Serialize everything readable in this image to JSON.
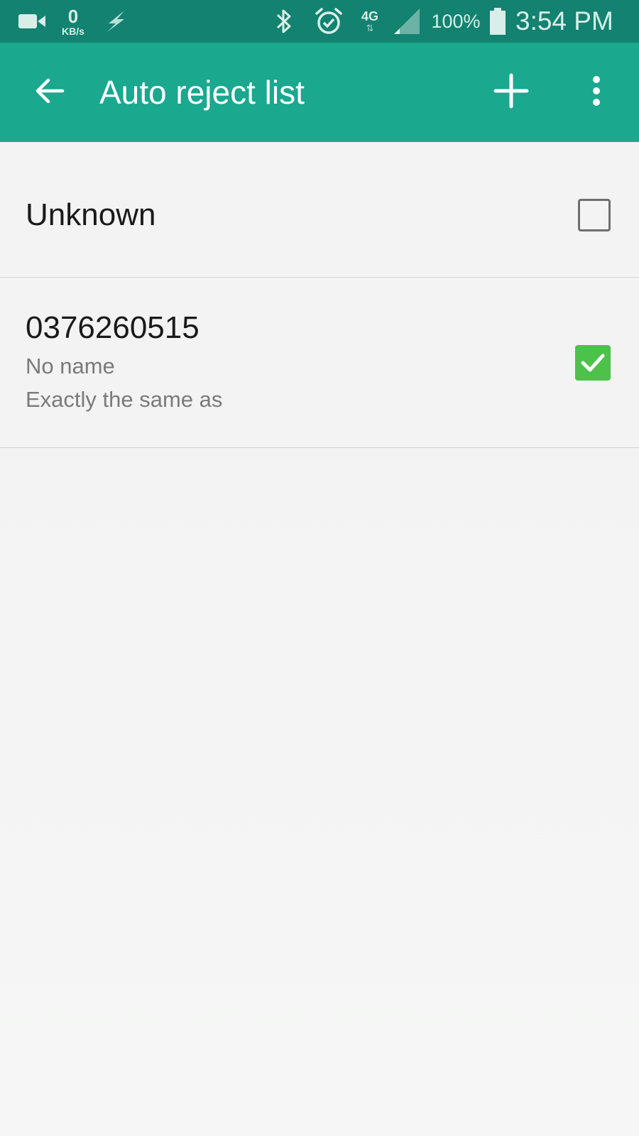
{
  "status_bar": {
    "network_speed_value": "0",
    "network_speed_unit": "KB/s",
    "network_type": "4G",
    "network_arrows": "⇅",
    "battery_percent": "100%",
    "time": "3:54 PM",
    "icons": [
      "video-icon",
      "flash-icon",
      "bluetooth-icon",
      "alarm-icon",
      "signal-icon",
      "battery-icon"
    ]
  },
  "app_bar": {
    "title": "Auto reject list",
    "icons": [
      "back-arrow-icon",
      "plus-icon",
      "more-vert-icon"
    ],
    "background_color": "#1aa88f"
  },
  "list": {
    "items": [
      {
        "primary": "Unknown",
        "checked": false
      },
      {
        "primary": "0376260515",
        "secondary_1": "No name",
        "secondary_2": "Exactly the same as",
        "checked": true
      }
    ]
  },
  "colors": {
    "status_bar": "#138270",
    "accent": "#1aa88f",
    "checkbox_checked": "#4cc24a",
    "background": "#f3f3f3"
  }
}
